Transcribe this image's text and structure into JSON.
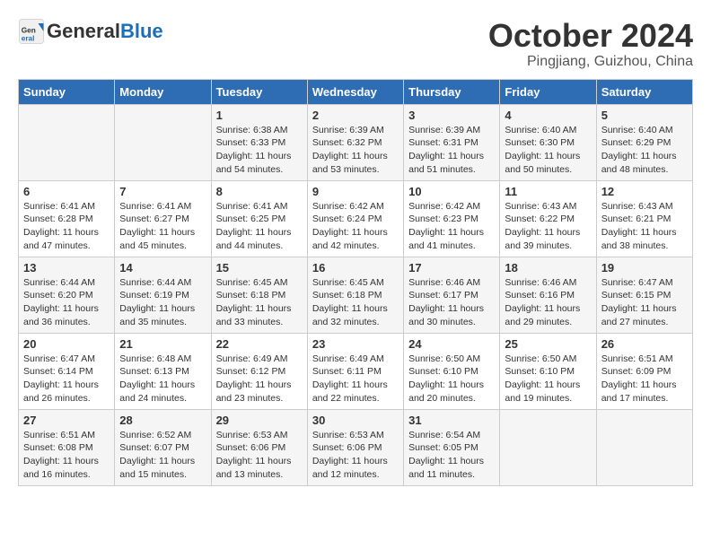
{
  "header": {
    "logo_general": "General",
    "logo_blue": "Blue",
    "month_title": "October 2024",
    "location": "Pingjiang, Guizhou, China"
  },
  "calendar": {
    "days_of_week": [
      "Sunday",
      "Monday",
      "Tuesday",
      "Wednesday",
      "Thursday",
      "Friday",
      "Saturday"
    ],
    "weeks": [
      [
        {
          "day": "",
          "info": ""
        },
        {
          "day": "",
          "info": ""
        },
        {
          "day": "1",
          "info": "Sunrise: 6:38 AM\nSunset: 6:33 PM\nDaylight: 11 hours and 54 minutes."
        },
        {
          "day": "2",
          "info": "Sunrise: 6:39 AM\nSunset: 6:32 PM\nDaylight: 11 hours and 53 minutes."
        },
        {
          "day": "3",
          "info": "Sunrise: 6:39 AM\nSunset: 6:31 PM\nDaylight: 11 hours and 51 minutes."
        },
        {
          "day": "4",
          "info": "Sunrise: 6:40 AM\nSunset: 6:30 PM\nDaylight: 11 hours and 50 minutes."
        },
        {
          "day": "5",
          "info": "Sunrise: 6:40 AM\nSunset: 6:29 PM\nDaylight: 11 hours and 48 minutes."
        }
      ],
      [
        {
          "day": "6",
          "info": "Sunrise: 6:41 AM\nSunset: 6:28 PM\nDaylight: 11 hours and 47 minutes."
        },
        {
          "day": "7",
          "info": "Sunrise: 6:41 AM\nSunset: 6:27 PM\nDaylight: 11 hours and 45 minutes."
        },
        {
          "day": "8",
          "info": "Sunrise: 6:41 AM\nSunset: 6:25 PM\nDaylight: 11 hours and 44 minutes."
        },
        {
          "day": "9",
          "info": "Sunrise: 6:42 AM\nSunset: 6:24 PM\nDaylight: 11 hours and 42 minutes."
        },
        {
          "day": "10",
          "info": "Sunrise: 6:42 AM\nSunset: 6:23 PM\nDaylight: 11 hours and 41 minutes."
        },
        {
          "day": "11",
          "info": "Sunrise: 6:43 AM\nSunset: 6:22 PM\nDaylight: 11 hours and 39 minutes."
        },
        {
          "day": "12",
          "info": "Sunrise: 6:43 AM\nSunset: 6:21 PM\nDaylight: 11 hours and 38 minutes."
        }
      ],
      [
        {
          "day": "13",
          "info": "Sunrise: 6:44 AM\nSunset: 6:20 PM\nDaylight: 11 hours and 36 minutes."
        },
        {
          "day": "14",
          "info": "Sunrise: 6:44 AM\nSunset: 6:19 PM\nDaylight: 11 hours and 35 minutes."
        },
        {
          "day": "15",
          "info": "Sunrise: 6:45 AM\nSunset: 6:18 PM\nDaylight: 11 hours and 33 minutes."
        },
        {
          "day": "16",
          "info": "Sunrise: 6:45 AM\nSunset: 6:18 PM\nDaylight: 11 hours and 32 minutes."
        },
        {
          "day": "17",
          "info": "Sunrise: 6:46 AM\nSunset: 6:17 PM\nDaylight: 11 hours and 30 minutes."
        },
        {
          "day": "18",
          "info": "Sunrise: 6:46 AM\nSunset: 6:16 PM\nDaylight: 11 hours and 29 minutes."
        },
        {
          "day": "19",
          "info": "Sunrise: 6:47 AM\nSunset: 6:15 PM\nDaylight: 11 hours and 27 minutes."
        }
      ],
      [
        {
          "day": "20",
          "info": "Sunrise: 6:47 AM\nSunset: 6:14 PM\nDaylight: 11 hours and 26 minutes."
        },
        {
          "day": "21",
          "info": "Sunrise: 6:48 AM\nSunset: 6:13 PM\nDaylight: 11 hours and 24 minutes."
        },
        {
          "day": "22",
          "info": "Sunrise: 6:49 AM\nSunset: 6:12 PM\nDaylight: 11 hours and 23 minutes."
        },
        {
          "day": "23",
          "info": "Sunrise: 6:49 AM\nSunset: 6:11 PM\nDaylight: 11 hours and 22 minutes."
        },
        {
          "day": "24",
          "info": "Sunrise: 6:50 AM\nSunset: 6:10 PM\nDaylight: 11 hours and 20 minutes."
        },
        {
          "day": "25",
          "info": "Sunrise: 6:50 AM\nSunset: 6:10 PM\nDaylight: 11 hours and 19 minutes."
        },
        {
          "day": "26",
          "info": "Sunrise: 6:51 AM\nSunset: 6:09 PM\nDaylight: 11 hours and 17 minutes."
        }
      ],
      [
        {
          "day": "27",
          "info": "Sunrise: 6:51 AM\nSunset: 6:08 PM\nDaylight: 11 hours and 16 minutes."
        },
        {
          "day": "28",
          "info": "Sunrise: 6:52 AM\nSunset: 6:07 PM\nDaylight: 11 hours and 15 minutes."
        },
        {
          "day": "29",
          "info": "Sunrise: 6:53 AM\nSunset: 6:06 PM\nDaylight: 11 hours and 13 minutes."
        },
        {
          "day": "30",
          "info": "Sunrise: 6:53 AM\nSunset: 6:06 PM\nDaylight: 11 hours and 12 minutes."
        },
        {
          "day": "31",
          "info": "Sunrise: 6:54 AM\nSunset: 6:05 PM\nDaylight: 11 hours and 11 minutes."
        },
        {
          "day": "",
          "info": ""
        },
        {
          "day": "",
          "info": ""
        }
      ]
    ]
  }
}
